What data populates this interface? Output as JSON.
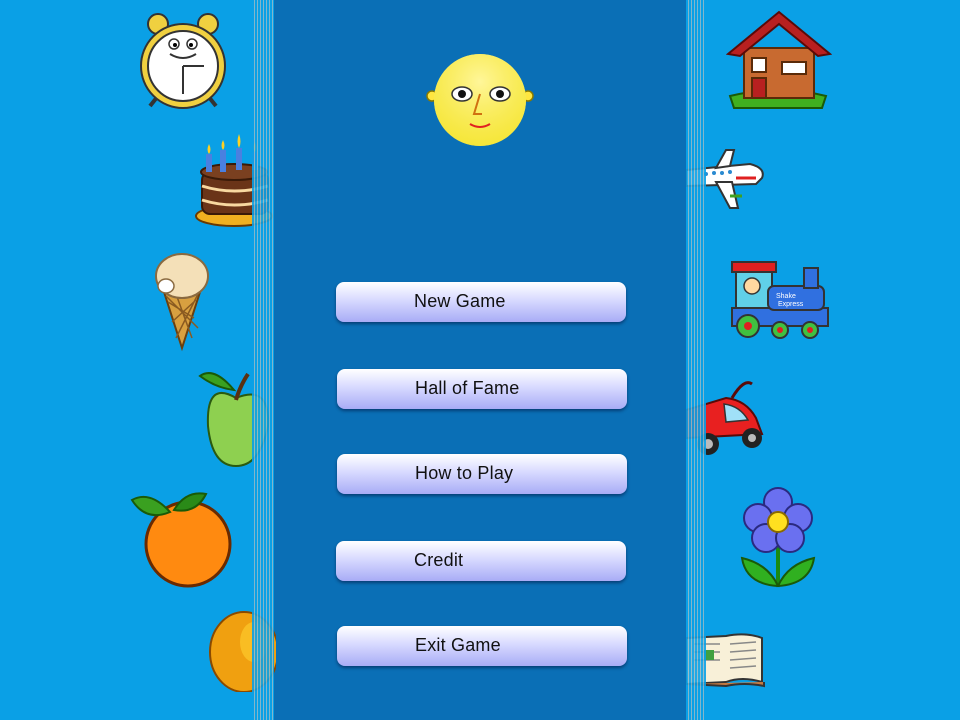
{
  "menu": {
    "new_game": "New Game",
    "hall_of_fame": "Hall of Fame",
    "how_to_play": "How to Play",
    "credit": "Credit",
    "exit_game": "Exit Game"
  },
  "decor": {
    "left_items": [
      "alarm-clock-icon",
      "birthday-cake-icon",
      "ice-cream-icon",
      "green-apple-icon",
      "orange-icon",
      "mango-icon"
    ],
    "right_items": [
      "house-icon",
      "airplane-icon",
      "toy-train-icon",
      "red-car-icon",
      "flower-icon",
      "open-book-icon"
    ],
    "train_text": [
      "Shake",
      "Express"
    ]
  },
  "colors": {
    "background": "#0aa0e6",
    "panel": "#0a6fb6",
    "button_top": "#ffffff",
    "button_bottom": "#a8acf6"
  }
}
